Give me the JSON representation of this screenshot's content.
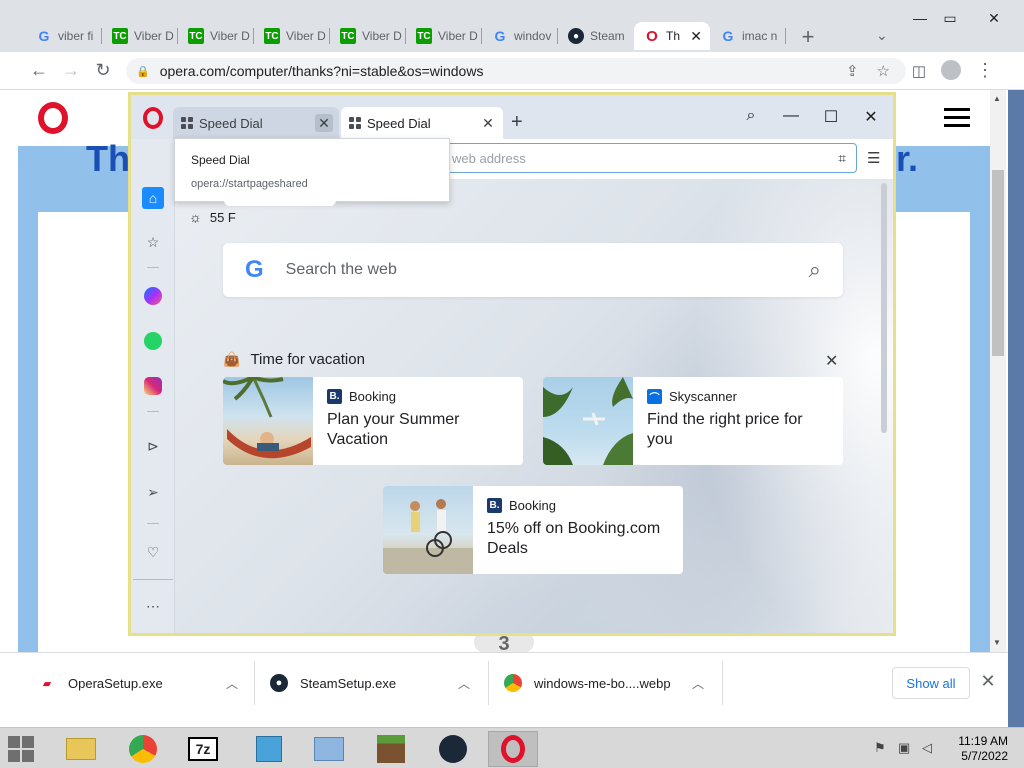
{
  "chrome": {
    "tabs": [
      {
        "label": "viber fi",
        "icon": "google-icon"
      },
      {
        "label": "Viber D",
        "icon": "techcrunch-icon"
      },
      {
        "label": "Viber D",
        "icon": "techcrunch-icon"
      },
      {
        "label": "Viber D",
        "icon": "techcrunch-icon"
      },
      {
        "label": "Viber D",
        "icon": "techcrunch-icon"
      },
      {
        "label": "Viber D",
        "icon": "techcrunch-icon"
      },
      {
        "label": "windov",
        "icon": "google-icon"
      },
      {
        "label": "Steam",
        "icon": "steam-icon"
      },
      {
        "label": "Th",
        "icon": "opera-icon",
        "active": true
      },
      {
        "label": "imac n",
        "icon": "google-icon"
      }
    ],
    "url": "opera.com/computer/thanks?ni=stable&os=windows",
    "page_heading_left": "Th",
    "page_heading_right": "r.",
    "page_step": "3"
  },
  "opera": {
    "tabs": [
      {
        "label": "Speed Dial",
        "active": false
      },
      {
        "label": "Speed Dial",
        "active": true
      }
    ],
    "address_placeholder": "web address",
    "tooltip": {
      "title": "Speed Dial",
      "url": "opera://startpageshared"
    },
    "weather": "55 F",
    "search_placeholder": "Search the web",
    "section_title": "Time for vacation",
    "cards": [
      {
        "source": "Booking",
        "title_line1": "Plan your Summer",
        "title_line2": "Vacation",
        "badge_color": "#1a3a6e"
      },
      {
        "source": "Skyscanner",
        "title_line1": "Find the right price for",
        "title_line2": "you",
        "badge_color": "#0770e3"
      },
      {
        "source": "Booking",
        "title_line1": "15% off on Booking.com",
        "title_line2": "Deals",
        "badge_color": "#1a3a6e"
      }
    ]
  },
  "downloads": [
    {
      "name": "OperaSetup.exe"
    },
    {
      "name": "SteamSetup.exe"
    },
    {
      "name": "windows-me-bo....webp"
    }
  ],
  "downloads_show_all": "Show all",
  "taskbar": {
    "time": "11:19 AM",
    "date": "5/7/2022"
  }
}
